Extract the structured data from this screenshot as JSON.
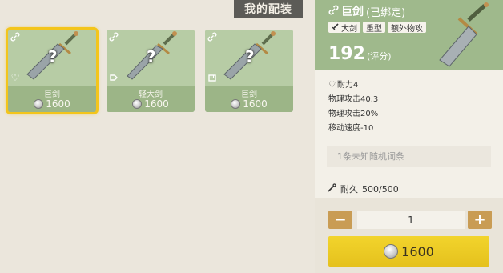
{
  "loadout_tab": "我的配装",
  "cards": [
    {
      "name": "巨剑",
      "price": "1600",
      "corner_icon": "heart-icon",
      "selected": true
    },
    {
      "name": "轻大剑",
      "price": "1600",
      "corner_icon": "shield-icon",
      "selected": false
    },
    {
      "name": "巨剑",
      "price": "1600",
      "corner_icon": "fist-icon",
      "selected": false
    }
  ],
  "detail": {
    "title": "巨剑",
    "bound": "(已绑定)",
    "tags": [
      "大剑",
      "重型",
      "额外物攻"
    ],
    "score": "192",
    "score_unit": "(评分)",
    "stats": {
      "durability_label": "耐力4",
      "attack_1": "物理攻击40.3",
      "attack_2": "物理攻击20%",
      "speed": "移动速度-10"
    },
    "affix_placeholder": "1条未知随机词条",
    "durab_label": "耐久",
    "durab_value": "500/500"
  },
  "purchase": {
    "minus": "−",
    "quantity": "1",
    "plus": "+",
    "price": "1600"
  },
  "colors": {
    "card_green": "#a9c096",
    "header_green": "#9fb98c",
    "select_gold": "#f3c51c",
    "buy_yellow": "#f2d42c",
    "stepper_gold": "#c99c54"
  }
}
